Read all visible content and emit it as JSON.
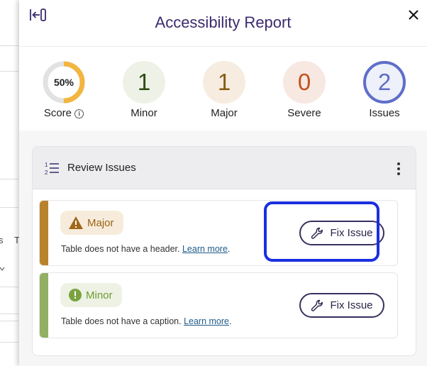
{
  "background": {
    "chars": [
      "s",
      "T"
    ]
  },
  "header": {
    "title": "Accessibility Report",
    "collapse_icon": "collapse-panel-icon",
    "close_icon": "close-icon"
  },
  "scores": {
    "score": {
      "value": "50%",
      "percent": 50,
      "label": "Score"
    },
    "minor": {
      "value": "1",
      "label": "Minor",
      "color": "#2f4a14",
      "bg": "#eef1e6"
    },
    "major": {
      "value": "1",
      "label": "Major",
      "color": "#8a5a12",
      "bg": "#f6ece0"
    },
    "severe": {
      "value": "0",
      "label": "Severe",
      "color": "#c2521f",
      "bg": "#f8e8e2"
    },
    "issues": {
      "value": "2",
      "label": "Issues",
      "color": "#5e6ec9",
      "bg": "#eef0fa"
    }
  },
  "review": {
    "title": "Review Issues",
    "issues": [
      {
        "severity": "Major",
        "description": "Table does not have a header.",
        "link": "Learn more",
        "button": "Fix Issue",
        "stripe_color": "#b9822c",
        "badge_bg": "#f7ecdc",
        "badge_color": "#9a6212"
      },
      {
        "severity": "Minor",
        "description": "Table does not have a caption.",
        "link": "Learn more",
        "button": "Fix Issue",
        "stripe_color": "#93b062",
        "badge_bg": "#eef2e4",
        "badge_color": "#6f9a36"
      }
    ]
  },
  "colors": {
    "accent": "#3c2a6e",
    "focus": "#1a2fe0",
    "score_track": "#e2e2e2",
    "score_fill": "#f2b640"
  }
}
